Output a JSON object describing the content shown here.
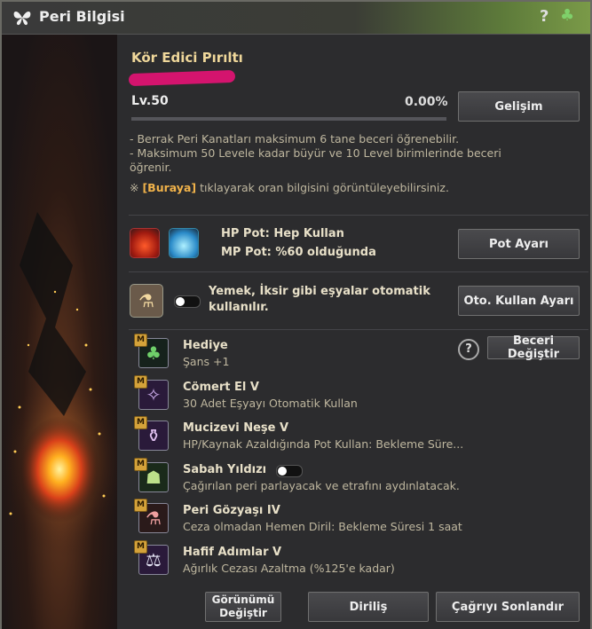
{
  "window": {
    "title": "Peri Bilgisi"
  },
  "peri": {
    "name": "Kör Edici Pırıltı",
    "level": "Lv.50",
    "exp_percent": "0.00%",
    "exp_fraction": 0.0,
    "grow_button": "Gelişim"
  },
  "info": {
    "line1": "- Berrak Peri Kanatları maksimum 6 tane beceri öğrenebilir.",
    "line2a": "- Maksimum 50 Levele kadar büyür ve 10 Level birimlerinde beceri",
    "line2b": "öğrenir.",
    "note_prefix": "※ ",
    "note_link": "[Buraya]",
    "note_suffix": " tıklayarak oran bilgisini görüntüleyebilirsiniz."
  },
  "potion": {
    "hp_label": "HP Pot: Hep Kullan",
    "mp_label": "MP Pot: %60 olduğunda",
    "settings_button": "Pot Ayarı"
  },
  "auto_use": {
    "label_line1": "Yemek, İksir gibi eşyalar otomatik",
    "label_line2": "kullanılır.",
    "settings_button": "Oto. Kullan Ayarı"
  },
  "skills": {
    "change_button": "Beceri Değiştir",
    "badge": "M",
    "items": [
      {
        "name": "Hediye",
        "desc": "Şans +1",
        "icon": "clover-icon"
      },
      {
        "name": "Cömert El V",
        "desc": "30 Adet Eşyayı Otomatik Kullan",
        "icon": "fairy-hand-icon"
      },
      {
        "name": "Mucizevi Neşe V",
        "desc": "HP/Kaynak Azaldığında Pot Kullan: Bekleme Süre...",
        "icon": "potion-plus-icon"
      },
      {
        "name": "Sabah Yıldızı",
        "desc": "Çağırılan peri parlayacak ve etrafını aydınlatacak.",
        "icon": "lantern-icon"
      },
      {
        "name": "Peri Gözyaşı IV",
        "desc": "Ceza olmadan Hemen Diril: Bekleme Süresi 1 saat",
        "icon": "tear-vial-icon"
      },
      {
        "name": "Hafif Adımlar V",
        "desc": "Ağırlık Cezası Azaltma (%125'e kadar)",
        "icon": "weight-icon"
      }
    ]
  },
  "footer": {
    "appearance_button": "Görünümü Değiştir",
    "revive_button": "Diriliş",
    "end_summon_button": "Çağrıyı Sonlandır"
  },
  "colors": {
    "accent": "#efd79a",
    "link": "#f0b24a",
    "redaction": "#d4146e"
  }
}
